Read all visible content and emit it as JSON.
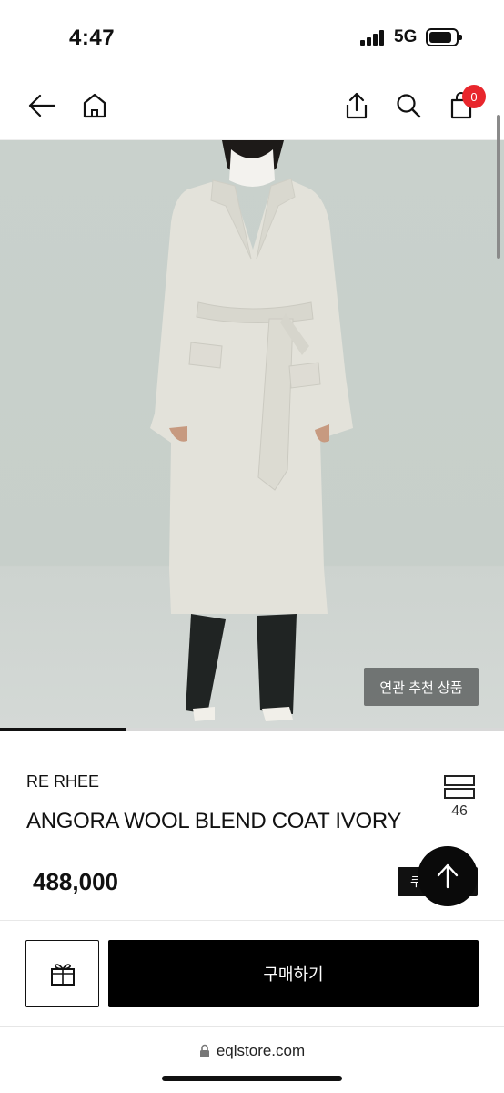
{
  "status_bar": {
    "time": "4:47",
    "network": "5G"
  },
  "nav": {
    "cart_count": "0"
  },
  "icons": {
    "back": "back-arrow-icon",
    "home": "home-icon",
    "share": "share-icon",
    "search": "search-icon",
    "cart": "shopping-bag-icon",
    "like": "like-icon",
    "gift": "gift-icon",
    "top": "arrow-up-icon",
    "lock": "lock-icon"
  },
  "hero": {
    "related_label": "연관 추천 상품",
    "image_progress": 0.25
  },
  "product": {
    "brand": "RE RHEE",
    "name": "ANGORA WOOL BLEND COAT IVORY",
    "price": "488,000",
    "like_count": "46",
    "coupon_label": "쿠"
  },
  "actions": {
    "buy_label": "구매하기"
  },
  "browser": {
    "url": "eqlstore.com"
  },
  "colors": {
    "badge": "#e8262c",
    "coat": "#e3e2da",
    "background": "#c9d1cc"
  }
}
